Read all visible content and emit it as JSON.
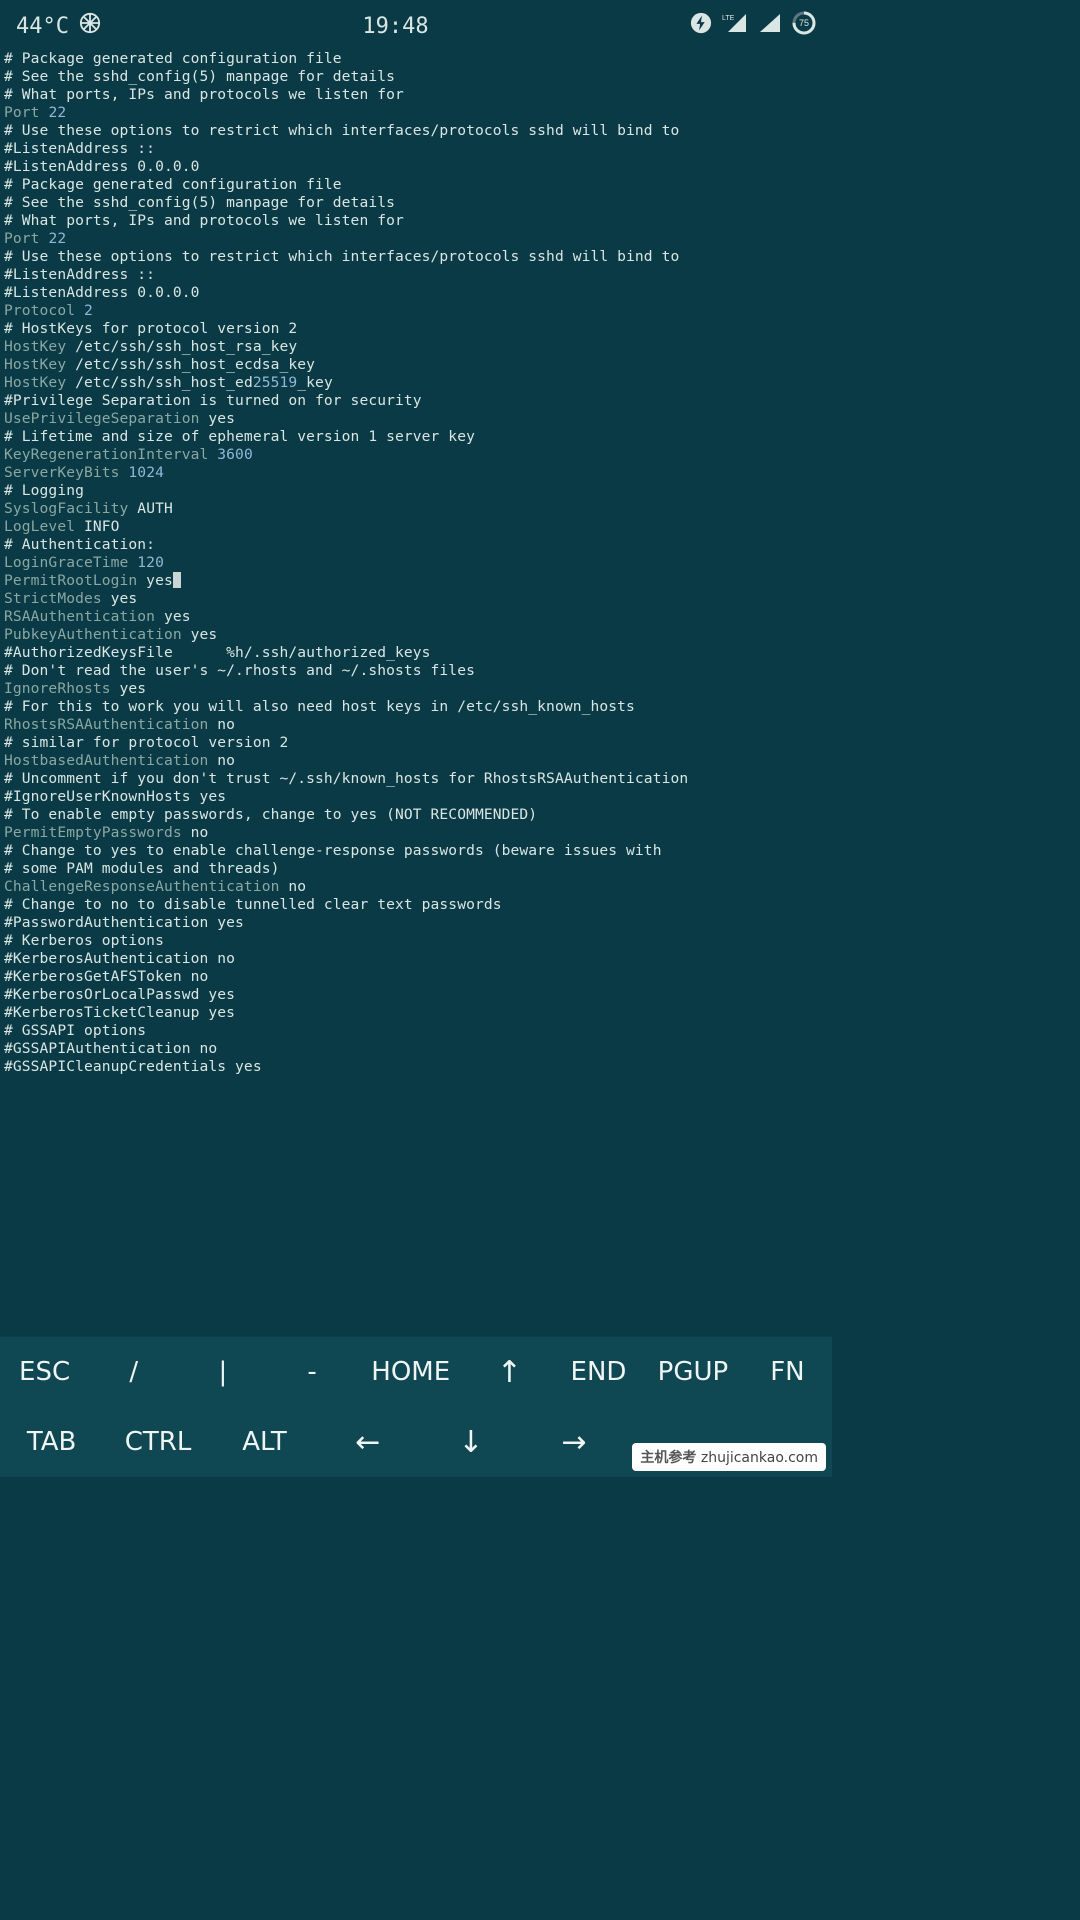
{
  "status": {
    "temp": "44°C",
    "clock": "19:48",
    "battery": "75"
  },
  "lines": [
    [
      [
        "v",
        "# Package generated configuration file"
      ]
    ],
    [
      [
        "v",
        "# See the sshd_config(5) manpage for details"
      ]
    ],
    [
      [
        "v",
        ""
      ]
    ],
    [
      [
        "v",
        "# What ports, IPs and protocols we listen for"
      ]
    ],
    [
      [
        "k",
        "Port "
      ],
      [
        "b",
        "22"
      ]
    ],
    [
      [
        "v",
        "# Use these options to restrict which interfaces/protocols sshd will bind to"
      ]
    ],
    [
      [
        "v",
        "#ListenAddress ::"
      ]
    ],
    [
      [
        "v",
        "#ListenAddress 0.0.0.0"
      ]
    ],
    [
      [
        "v",
        "# Package generated configuration file"
      ]
    ],
    [
      [
        "v",
        "# See the sshd_config(5) manpage for details"
      ]
    ],
    [
      [
        "v",
        ""
      ]
    ],
    [
      [
        "v",
        "# What ports, IPs and protocols we listen for"
      ]
    ],
    [
      [
        "k",
        "Port "
      ],
      [
        "b",
        "22"
      ]
    ],
    [
      [
        "v",
        "# Use these options to restrict which interfaces/protocols sshd will bind to"
      ]
    ],
    [
      [
        "v",
        "#ListenAddress ::"
      ]
    ],
    [
      [
        "v",
        "#ListenAddress 0.0.0.0"
      ]
    ],
    [
      [
        "k",
        "Protocol "
      ],
      [
        "b",
        "2"
      ]
    ],
    [
      [
        "v",
        "# HostKeys for protocol version 2"
      ]
    ],
    [
      [
        "k",
        "HostKey"
      ],
      [
        "v",
        " /etc/ssh/ssh_host_rsa_key"
      ]
    ],
    [
      [
        "k",
        "HostKey"
      ],
      [
        "v",
        " /etc/ssh/ssh_host_ecdsa_key"
      ]
    ],
    [
      [
        "k",
        "HostKey"
      ],
      [
        "v",
        " /etc/ssh/ssh_host_ed"
      ],
      [
        "b",
        "25519"
      ],
      [
        "v",
        "_key"
      ]
    ],
    [
      [
        "v",
        "#Privilege Separation is turned on for security"
      ]
    ],
    [
      [
        "k",
        "UsePrivilegeSeparation"
      ],
      [
        "v",
        " yes"
      ]
    ],
    [
      [
        "v",
        ""
      ]
    ],
    [
      [
        "v",
        "# Lifetime and size of ephemeral version 1 server key"
      ]
    ],
    [
      [
        "k",
        "KeyRegenerationInterval "
      ],
      [
        "b",
        "3600"
      ]
    ],
    [
      [
        "k",
        "ServerKeyBits "
      ],
      [
        "b",
        "1024"
      ]
    ],
    [
      [
        "v",
        ""
      ]
    ],
    [
      [
        "v",
        "# Logging"
      ]
    ],
    [
      [
        "k",
        "SyslogFacility"
      ],
      [
        "v",
        " AUTH"
      ]
    ],
    [
      [
        "k",
        "LogLevel"
      ],
      [
        "v",
        " INFO"
      ]
    ],
    [
      [
        "v",
        ""
      ]
    ],
    [
      [
        "v",
        "# Authentication:"
      ]
    ],
    [
      [
        "k",
        "LoginGraceTime "
      ],
      [
        "b",
        "120"
      ]
    ],
    [
      [
        "k",
        "PermitRootLogin"
      ],
      [
        "v",
        " yes"
      ],
      [
        "cursor",
        ""
      ]
    ],
    [
      [
        "k",
        "StrictModes"
      ],
      [
        "v",
        " yes"
      ]
    ],
    [
      [
        "v",
        ""
      ]
    ],
    [
      [
        "k",
        "RSAAuthentication"
      ],
      [
        "v",
        " yes"
      ]
    ],
    [
      [
        "k",
        "PubkeyAuthentication"
      ],
      [
        "v",
        " yes"
      ]
    ],
    [
      [
        "v",
        "#AuthorizedKeysFile      %h/.ssh/authorized_keys"
      ]
    ],
    [
      [
        "v",
        ""
      ]
    ],
    [
      [
        "v",
        "# Don't read the user's ~/.rhosts and ~/.shosts files"
      ]
    ],
    [
      [
        "k",
        "IgnoreRhosts"
      ],
      [
        "v",
        " yes"
      ]
    ],
    [
      [
        "v",
        "# For this to work you will also need host keys in /etc/ssh_known_hosts"
      ]
    ],
    [
      [
        "k",
        "RhostsRSAAuthentication"
      ],
      [
        "v",
        " no"
      ]
    ],
    [
      [
        "v",
        "# similar for protocol version 2"
      ]
    ],
    [
      [
        "k",
        "HostbasedAuthentication"
      ],
      [
        "v",
        " no"
      ]
    ],
    [
      [
        "v",
        "# Uncomment if you don't trust ~/.ssh/known_hosts for RhostsRSAAuthentication"
      ]
    ],
    [
      [
        "v",
        "#IgnoreUserKnownHosts yes"
      ]
    ],
    [
      [
        "v",
        ""
      ]
    ],
    [
      [
        "v",
        "# To enable empty passwords, change to yes (NOT RECOMMENDED)"
      ]
    ],
    [
      [
        "k",
        "PermitEmptyPasswords"
      ],
      [
        "v",
        " no"
      ]
    ],
    [
      [
        "v",
        ""
      ]
    ],
    [
      [
        "v",
        "# Change to yes to enable challenge-response passwords (beware issues with"
      ]
    ],
    [
      [
        "v",
        "# some PAM modules and threads)"
      ]
    ],
    [
      [
        "k",
        "ChallengeResponseAuthentication"
      ],
      [
        "v",
        " no"
      ]
    ],
    [
      [
        "v",
        ""
      ]
    ],
    [
      [
        "v",
        "# Change to no to disable tunnelled clear text passwords"
      ]
    ],
    [
      [
        "v",
        "#PasswordAuthentication yes"
      ]
    ],
    [
      [
        "v",
        ""
      ]
    ],
    [
      [
        "v",
        "# Kerberos options"
      ]
    ],
    [
      [
        "v",
        "#KerberosAuthentication no"
      ]
    ],
    [
      [
        "v",
        "#KerberosGetAFSToken no"
      ]
    ],
    [
      [
        "v",
        "#KerberosOrLocalPasswd yes"
      ]
    ],
    [
      [
        "v",
        "#KerberosTicketCleanup yes"
      ]
    ],
    [
      [
        "v",
        ""
      ]
    ],
    [
      [
        "v",
        "# GSSAPI options"
      ]
    ],
    [
      [
        "v",
        "#GSSAPIAuthentication no"
      ]
    ],
    [
      [
        "v",
        "#GSSAPICleanupCredentials yes"
      ]
    ]
  ],
  "keys": {
    "row1": [
      "ESC",
      "/",
      "|",
      "-",
      "HOME",
      "↑",
      "END",
      "PGUP",
      "FN"
    ],
    "row2": [
      "TAB",
      "CTRL",
      "ALT",
      "←",
      "↓",
      "→",
      "",
      ""
    ]
  },
  "watermark": {
    "left": "主机参考",
    "right": "zhujicankao.com"
  }
}
